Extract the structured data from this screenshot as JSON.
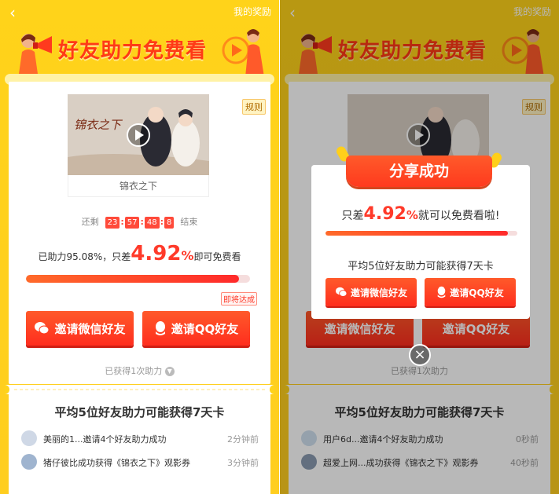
{
  "header": {
    "back_icon": "back-arrow-icon",
    "reward_link": "我的奖励",
    "title": "好友助力免费看"
  },
  "left": {
    "rules": "规则",
    "poster_title": "锦衣之下",
    "poster_caption": "锦衣之下",
    "countdown": {
      "prefix": "还剩",
      "h": "23",
      "m": "57",
      "s": "48",
      "ms": "8",
      "suffix": "结束"
    },
    "progress": {
      "prefix": "已助力95.08%，只差",
      "big": "4.92",
      "pct": "%",
      "suffix": "即可免费看"
    },
    "progress_fraction": 0.9508,
    "almost": "即将达成",
    "btn_wechat": "邀请微信好友",
    "btn_qq": "邀请QQ好友",
    "got": "已获得1次助力",
    "avg": "平均5位好友助力可能获得7天卡",
    "feed": [
      {
        "text": "美丽的1...邀请4个好友助力成功",
        "time": "2分钟前"
      },
      {
        "text": "猪仔彼比成功获得《锦衣之下》观影券",
        "time": "3分钟前"
      }
    ]
  },
  "right": {
    "rules": "规则",
    "modal": {
      "ribbon": "分享成功",
      "text_prefix": "只差",
      "big": "4.92",
      "pct": "%",
      "text_suffix": "就可以免费看啦!",
      "avg": "平均5位好友助力可能获得7天卡",
      "btn_wechat": "邀请微信好友",
      "btn_qq": "邀请QQ好友"
    },
    "bg_btn_wechat": "邀请微信好友",
    "bg_btn_qq": "邀请QQ好友",
    "got": "已获得1次助力",
    "avg": "平均5位好友助力可能获得7天卡",
    "feed": [
      {
        "text": "用户6d...邀请4个好友助力成功",
        "time": "0秒前"
      },
      {
        "text": "超爱上网...成功获得《锦衣之下》观影券",
        "time": "40秒前"
      }
    ]
  },
  "colors": {
    "yellow": "#ffd31a",
    "accent": "#ff3a2a"
  }
}
